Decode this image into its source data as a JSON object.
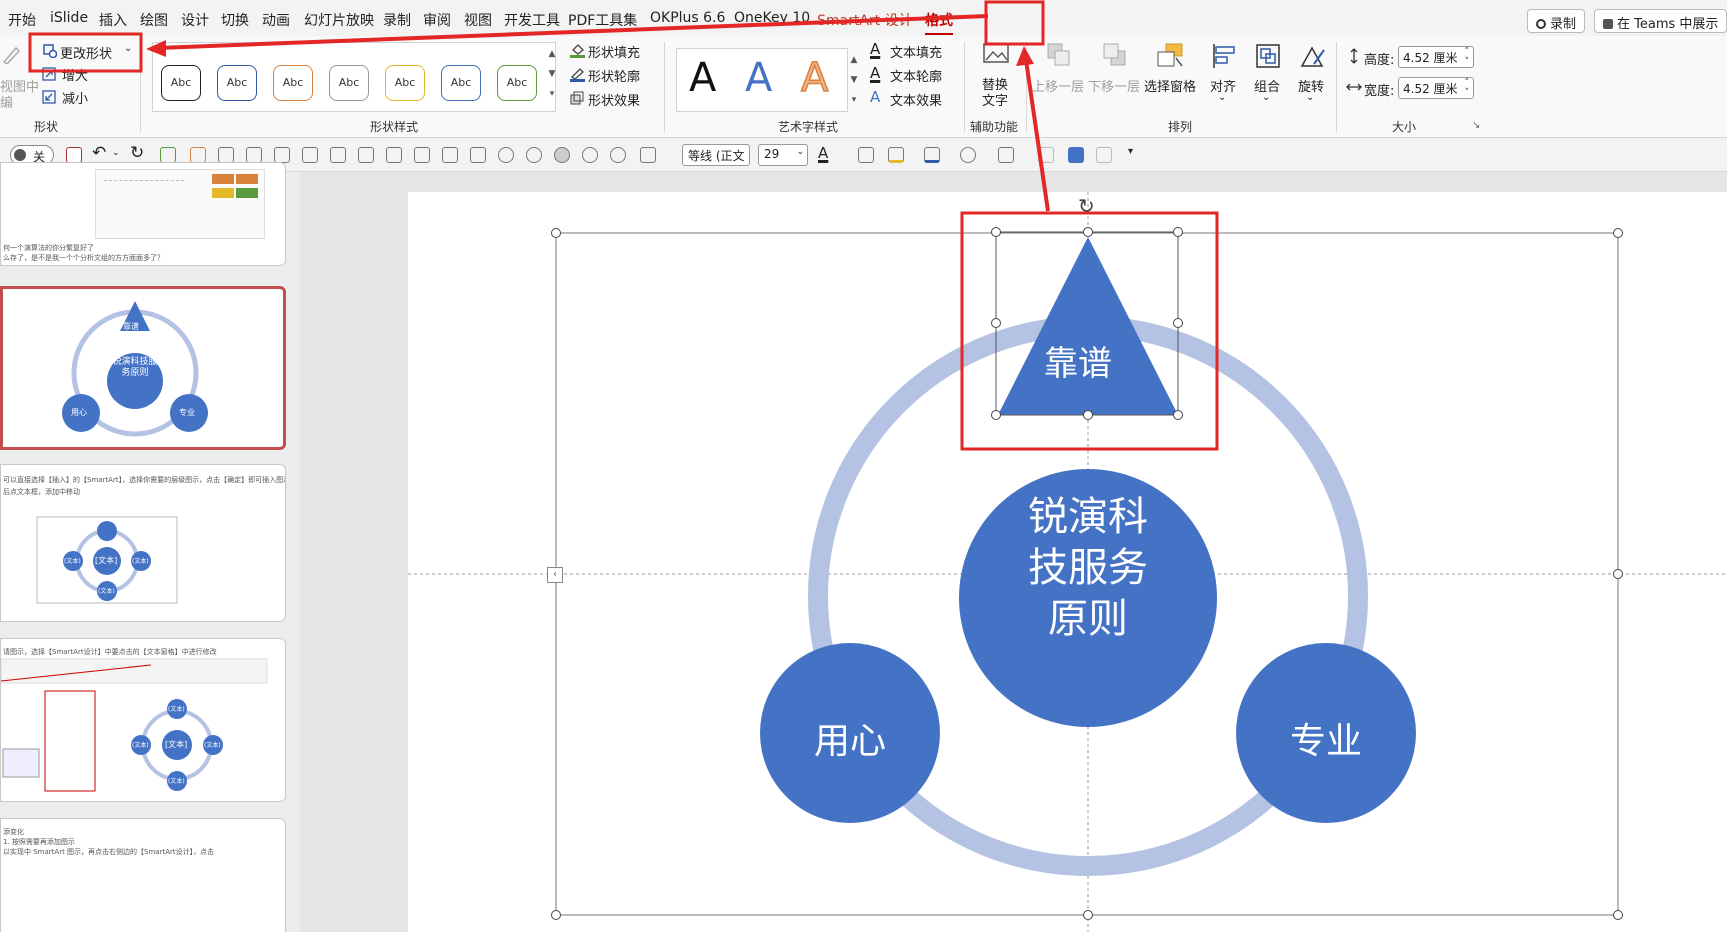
{
  "tabs": [
    "开始",
    "iSlide",
    "插入",
    "绘图",
    "设计",
    "切换",
    "动画",
    "幻灯片放映",
    "录制",
    "审阅",
    "视图",
    "开发工具",
    "PDF工具集",
    "OKPlus 6.6",
    "OneKey 10",
    "SmartArt 设计",
    "格式"
  ],
  "top_buttons": {
    "record": "录制",
    "teams": "在 Teams 中展示"
  },
  "ribbon": {
    "shape_group": {
      "edit_view": "视图中",
      "edit_view2": "编",
      "change_shape": "更改形状",
      "larger": "增大",
      "smaller": "减小",
      "label": "形状"
    },
    "shape_styles": {
      "sample": "Abc",
      "fill": "形状填充",
      "outline": "形状轮廓",
      "effects": "形状效果",
      "label": "形状样式"
    },
    "wordart": {
      "sample": "A",
      "text_fill": "文本填充",
      "text_outline": "文本轮廓",
      "text_effects": "文本效果",
      "label": "艺术字样式"
    },
    "accessibility": {
      "alt_text_1": "替换",
      "alt_text_2": "文字",
      "label": "辅助功能"
    },
    "arrange": {
      "bring_forward": "上移一层",
      "send_backward": "下移一层",
      "selection_pane": "选择窗格",
      "align": "对齐",
      "group": "组合",
      "rotate": "旋转",
      "label": "排列"
    },
    "size": {
      "height_label": "高度:",
      "height_value": "4.52 厘米",
      "width_label": "宽度:",
      "width_value": "4.52 厘米",
      "label": "大小"
    }
  },
  "quickbar": {
    "toggle_label": "关",
    "font_name": "等线 (正文",
    "font_size": "29"
  },
  "thumbnails": {
    "t1_lines": [
      "何一个演算法的你分繁复好了",
      "么存了，是不是我一个个分析文组的方方面面多了？"
    ],
    "t2": {
      "triangle": "靠谱",
      "center": "锐演科技服务原则",
      "left": "用心",
      "right": "专业"
    },
    "t3_lines": [
      "可以直接选择【插入】的【SmartArt】，选择你需要的层级图示，点击【确定】即可插入图示。",
      "后点文本框，添加中移动"
    ],
    "t3_nodes": {
      "center": "[文本]",
      "node": "(文本)"
    },
    "t4_lines": [
      "请图示，选择【SmartArt设计】中要点击的【文本窗格】中进行修改"
    ],
    "t4_nodes": {
      "center": "[文本]",
      "node": "(文本)"
    },
    "t5_lines": [
      "添变化",
      "1. 按照需要再添加图示",
      "以实现中 SmartArt 图示，再点击右侧边的【SmartArt设计】，点击"
    ]
  },
  "slide": {
    "triangle_label": "靠谱",
    "center_lines": [
      "锐演科",
      "技服务",
      "原则"
    ],
    "left_label": "用心",
    "right_label": "专业"
  },
  "colors": {
    "accent": "#4472c4",
    "ring": "#b4c2e3",
    "annotation": "#e32626"
  }
}
